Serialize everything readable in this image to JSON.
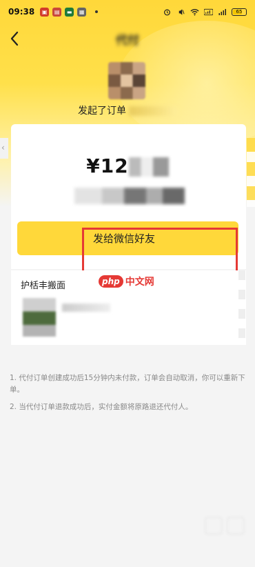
{
  "status_bar": {
    "time": "09:38",
    "battery": "65"
  },
  "nav": {
    "title": "代付"
  },
  "initiator": {
    "text": "发起了订单"
  },
  "order": {
    "amount_prefix": "¥12"
  },
  "share_button": {
    "label": "发给微信好友"
  },
  "product": {
    "name": "护栝丰搬面"
  },
  "watermark": {
    "logo": "php",
    "text": "中文网"
  },
  "notes": [
    "1. 代付订单创建成功后15分钟内未付款，订单会自动取消，你可以重新下单。",
    "2. 当代付订单退款成功后，实付金额将原路退还代付人。"
  ],
  "colors": {
    "accent": "#ffd83a",
    "highlight": "#e53935"
  }
}
